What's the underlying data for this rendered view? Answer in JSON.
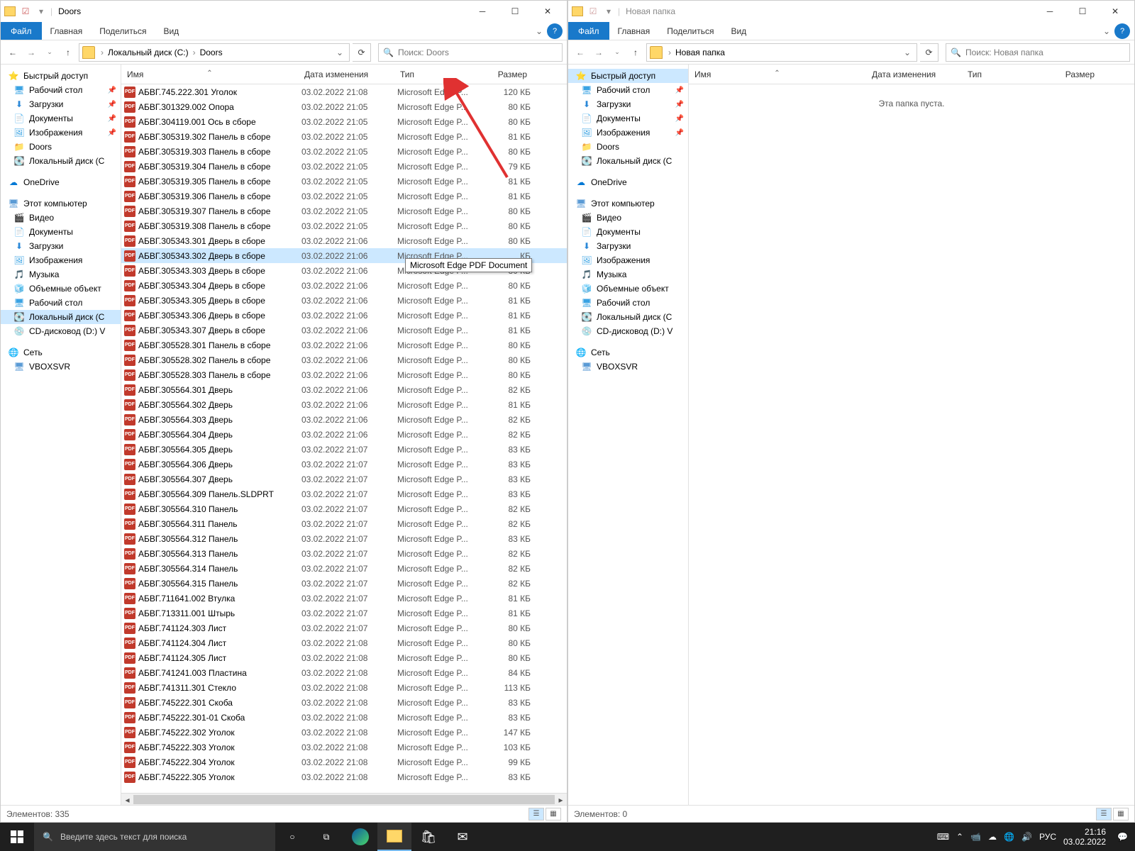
{
  "left_window": {
    "title": "Doors",
    "ribbon": {
      "file": "Файл",
      "home": "Главная",
      "share": "Поделиться",
      "view": "Вид"
    },
    "path": {
      "disk": "Локальный диск (C:)",
      "folder": "Doors"
    },
    "search_placeholder": "Поиск: Doors",
    "columns": {
      "name": "Имя",
      "date": "Дата изменения",
      "type": "Тип",
      "size": "Размер"
    },
    "tooltip_text": "Microsoft Edge PDF Document",
    "status": "Элементов: 335",
    "files": [
      {
        "name": "АБВГ.745.222.301 Уголок",
        "date": "03.02.2022 21:08",
        "type": "Microsoft Edge P...",
        "size": "120 КБ"
      },
      {
        "name": "АБВГ.301329.002 Опора",
        "date": "03.02.2022 21:05",
        "type": "Microsoft Edge P...",
        "size": "80 КБ"
      },
      {
        "name": "АБВГ.304119.001 Ось в сборе",
        "date": "03.02.2022 21:05",
        "type": "Microsoft Edge P...",
        "size": "80 КБ"
      },
      {
        "name": "АБВГ.305319.302 Панель в сборе",
        "date": "03.02.2022 21:05",
        "type": "Microsoft Edge P...",
        "size": "81 КБ"
      },
      {
        "name": "АБВГ.305319.303 Панель в сборе",
        "date": "03.02.2022 21:05",
        "type": "Microsoft Edge P...",
        "size": "80 КБ"
      },
      {
        "name": "АБВГ.305319.304 Панель в сборе",
        "date": "03.02.2022 21:05",
        "type": "Microsoft Edge P...",
        "size": "79 КБ"
      },
      {
        "name": "АБВГ.305319.305 Панель в сборе",
        "date": "03.02.2022 21:05",
        "type": "Microsoft Edge P...",
        "size": "81 КБ"
      },
      {
        "name": "АБВГ.305319.306 Панель в сборе",
        "date": "03.02.2022 21:05",
        "type": "Microsoft Edge P...",
        "size": "81 КБ"
      },
      {
        "name": "АБВГ.305319.307 Панель в сборе",
        "date": "03.02.2022 21:05",
        "type": "Microsoft Edge P...",
        "size": "80 КБ"
      },
      {
        "name": "АБВГ.305319.308 Панель в сборе",
        "date": "03.02.2022 21:05",
        "type": "Microsoft Edge P...",
        "size": "80 КБ"
      },
      {
        "name": "АБВГ.305343.301 Дверь в сборе",
        "date": "03.02.2022 21:06",
        "type": "Microsoft Edge P...",
        "size": "80 КБ"
      },
      {
        "name": "АБВГ.305343.302 Дверь в сборе",
        "date": "03.02.2022 21:06",
        "type": "Microsoft Edge P...",
        "size": "КБ",
        "selected": true
      },
      {
        "name": "АБВГ.305343.303 Дверь в сборе",
        "date": "03.02.2022 21:06",
        "type": "Microsoft Edge P...",
        "size": "80 КБ"
      },
      {
        "name": "АБВГ.305343.304 Дверь в сборе",
        "date": "03.02.2022 21:06",
        "type": "Microsoft Edge P...",
        "size": "80 КБ"
      },
      {
        "name": "АБВГ.305343.305 Дверь в сборе",
        "date": "03.02.2022 21:06",
        "type": "Microsoft Edge P...",
        "size": "81 КБ"
      },
      {
        "name": "АБВГ.305343.306 Дверь в сборе",
        "date": "03.02.2022 21:06",
        "type": "Microsoft Edge P...",
        "size": "81 КБ"
      },
      {
        "name": "АБВГ.305343.307 Дверь в сборе",
        "date": "03.02.2022 21:06",
        "type": "Microsoft Edge P...",
        "size": "81 КБ"
      },
      {
        "name": "АБВГ.305528.301 Панель в сборе",
        "date": "03.02.2022 21:06",
        "type": "Microsoft Edge P...",
        "size": "80 КБ"
      },
      {
        "name": "АБВГ.305528.302 Панель в сборе",
        "date": "03.02.2022 21:06",
        "type": "Microsoft Edge P...",
        "size": "80 КБ"
      },
      {
        "name": "АБВГ.305528.303 Панель в сборе",
        "date": "03.02.2022 21:06",
        "type": "Microsoft Edge P...",
        "size": "80 КБ"
      },
      {
        "name": "АБВГ.305564.301 Дверь",
        "date": "03.02.2022 21:06",
        "type": "Microsoft Edge P...",
        "size": "82 КБ"
      },
      {
        "name": "АБВГ.305564.302 Дверь",
        "date": "03.02.2022 21:06",
        "type": "Microsoft Edge P...",
        "size": "81 КБ"
      },
      {
        "name": "АБВГ.305564.303 Дверь",
        "date": "03.02.2022 21:06",
        "type": "Microsoft Edge P...",
        "size": "82 КБ"
      },
      {
        "name": "АБВГ.305564.304 Дверь",
        "date": "03.02.2022 21:06",
        "type": "Microsoft Edge P...",
        "size": "82 КБ"
      },
      {
        "name": "АБВГ.305564.305 Дверь",
        "date": "03.02.2022 21:07",
        "type": "Microsoft Edge P...",
        "size": "83 КБ"
      },
      {
        "name": "АБВГ.305564.306 Дверь",
        "date": "03.02.2022 21:07",
        "type": "Microsoft Edge P...",
        "size": "83 КБ"
      },
      {
        "name": "АБВГ.305564.307 Дверь",
        "date": "03.02.2022 21:07",
        "type": "Microsoft Edge P...",
        "size": "83 КБ"
      },
      {
        "name": "АБВГ.305564.309 Панель.SLDPRT",
        "date": "03.02.2022 21:07",
        "type": "Microsoft Edge P...",
        "size": "83 КБ"
      },
      {
        "name": "АБВГ.305564.310 Панель",
        "date": "03.02.2022 21:07",
        "type": "Microsoft Edge P...",
        "size": "82 КБ"
      },
      {
        "name": "АБВГ.305564.311 Панель",
        "date": "03.02.2022 21:07",
        "type": "Microsoft Edge P...",
        "size": "82 КБ"
      },
      {
        "name": "АБВГ.305564.312 Панель",
        "date": "03.02.2022 21:07",
        "type": "Microsoft Edge P...",
        "size": "83 КБ"
      },
      {
        "name": "АБВГ.305564.313 Панель",
        "date": "03.02.2022 21:07",
        "type": "Microsoft Edge P...",
        "size": "82 КБ"
      },
      {
        "name": "АБВГ.305564.314 Панель",
        "date": "03.02.2022 21:07",
        "type": "Microsoft Edge P...",
        "size": "82 КБ"
      },
      {
        "name": "АБВГ.305564.315 Панель",
        "date": "03.02.2022 21:07",
        "type": "Microsoft Edge P...",
        "size": "82 КБ"
      },
      {
        "name": "АБВГ.711641.002 Втулка",
        "date": "03.02.2022 21:07",
        "type": "Microsoft Edge P...",
        "size": "81 КБ"
      },
      {
        "name": "АБВГ.713311.001 Штырь",
        "date": "03.02.2022 21:07",
        "type": "Microsoft Edge P...",
        "size": "81 КБ"
      },
      {
        "name": "АБВГ.741124.303 Лист",
        "date": "03.02.2022 21:07",
        "type": "Microsoft Edge P...",
        "size": "80 КБ"
      },
      {
        "name": "АБВГ.741124.304 Лист",
        "date": "03.02.2022 21:08",
        "type": "Microsoft Edge P...",
        "size": "80 КБ"
      },
      {
        "name": "АБВГ.741124.305 Лист",
        "date": "03.02.2022 21:08",
        "type": "Microsoft Edge P...",
        "size": "80 КБ"
      },
      {
        "name": "АБВГ.741241.003 Пластина",
        "date": "03.02.2022 21:08",
        "type": "Microsoft Edge P...",
        "size": "84 КБ"
      },
      {
        "name": "АБВГ.741311.301 Стекло",
        "date": "03.02.2022 21:08",
        "type": "Microsoft Edge P...",
        "size": "113 КБ"
      },
      {
        "name": "АБВГ.745222.301 Скоба",
        "date": "03.02.2022 21:08",
        "type": "Microsoft Edge P...",
        "size": "83 КБ"
      },
      {
        "name": "АБВГ.745222.301-01 Скоба",
        "date": "03.02.2022 21:08",
        "type": "Microsoft Edge P...",
        "size": "83 КБ"
      },
      {
        "name": "АБВГ.745222.302 Уголок",
        "date": "03.02.2022 21:08",
        "type": "Microsoft Edge P...",
        "size": "147 КБ"
      },
      {
        "name": "АБВГ.745222.303 Уголок",
        "date": "03.02.2022 21:08",
        "type": "Microsoft Edge P...",
        "size": "103 КБ"
      },
      {
        "name": "АБВГ.745222.304 Уголок",
        "date": "03.02.2022 21:08",
        "type": "Microsoft Edge P...",
        "size": "99 КБ"
      },
      {
        "name": "АБВГ.745222.305 Уголок",
        "date": "03.02.2022 21:08",
        "type": "Microsoft Edge P...",
        "size": "83 КБ"
      }
    ]
  },
  "right_window": {
    "title": "Новая папка",
    "ribbon": {
      "file": "Файл",
      "home": "Главная",
      "share": "Поделиться",
      "view": "Вид"
    },
    "path": {
      "folder": "Новая папка"
    },
    "search_placeholder": "Поиск: Новая папка",
    "columns": {
      "name": "Имя",
      "date": "Дата изменения",
      "type": "Тип",
      "size": "Размер"
    },
    "empty": "Эта папка пуста.",
    "status": "Элементов: 0"
  },
  "nav": {
    "quick": "Быстрый доступ",
    "desktop": "Рабочий стол",
    "downloads": "Загрузки",
    "documents": "Документы",
    "pictures": "Изображения",
    "doors": "Doors",
    "local_disk": "Локальный диск (C",
    "onedrive": "OneDrive",
    "this_pc": "Этот компьютер",
    "video": "Видео",
    "music": "Музыка",
    "volumes": "Объемные объект",
    "cd_drive": "CD-дисковод (D:) V",
    "network": "Сеть",
    "vboxsvr": "VBOXSVR"
  },
  "taskbar": {
    "search": "Введите здесь текст для поиска",
    "time": "21:16",
    "date": "03.02.2022",
    "lang": "РУС"
  }
}
